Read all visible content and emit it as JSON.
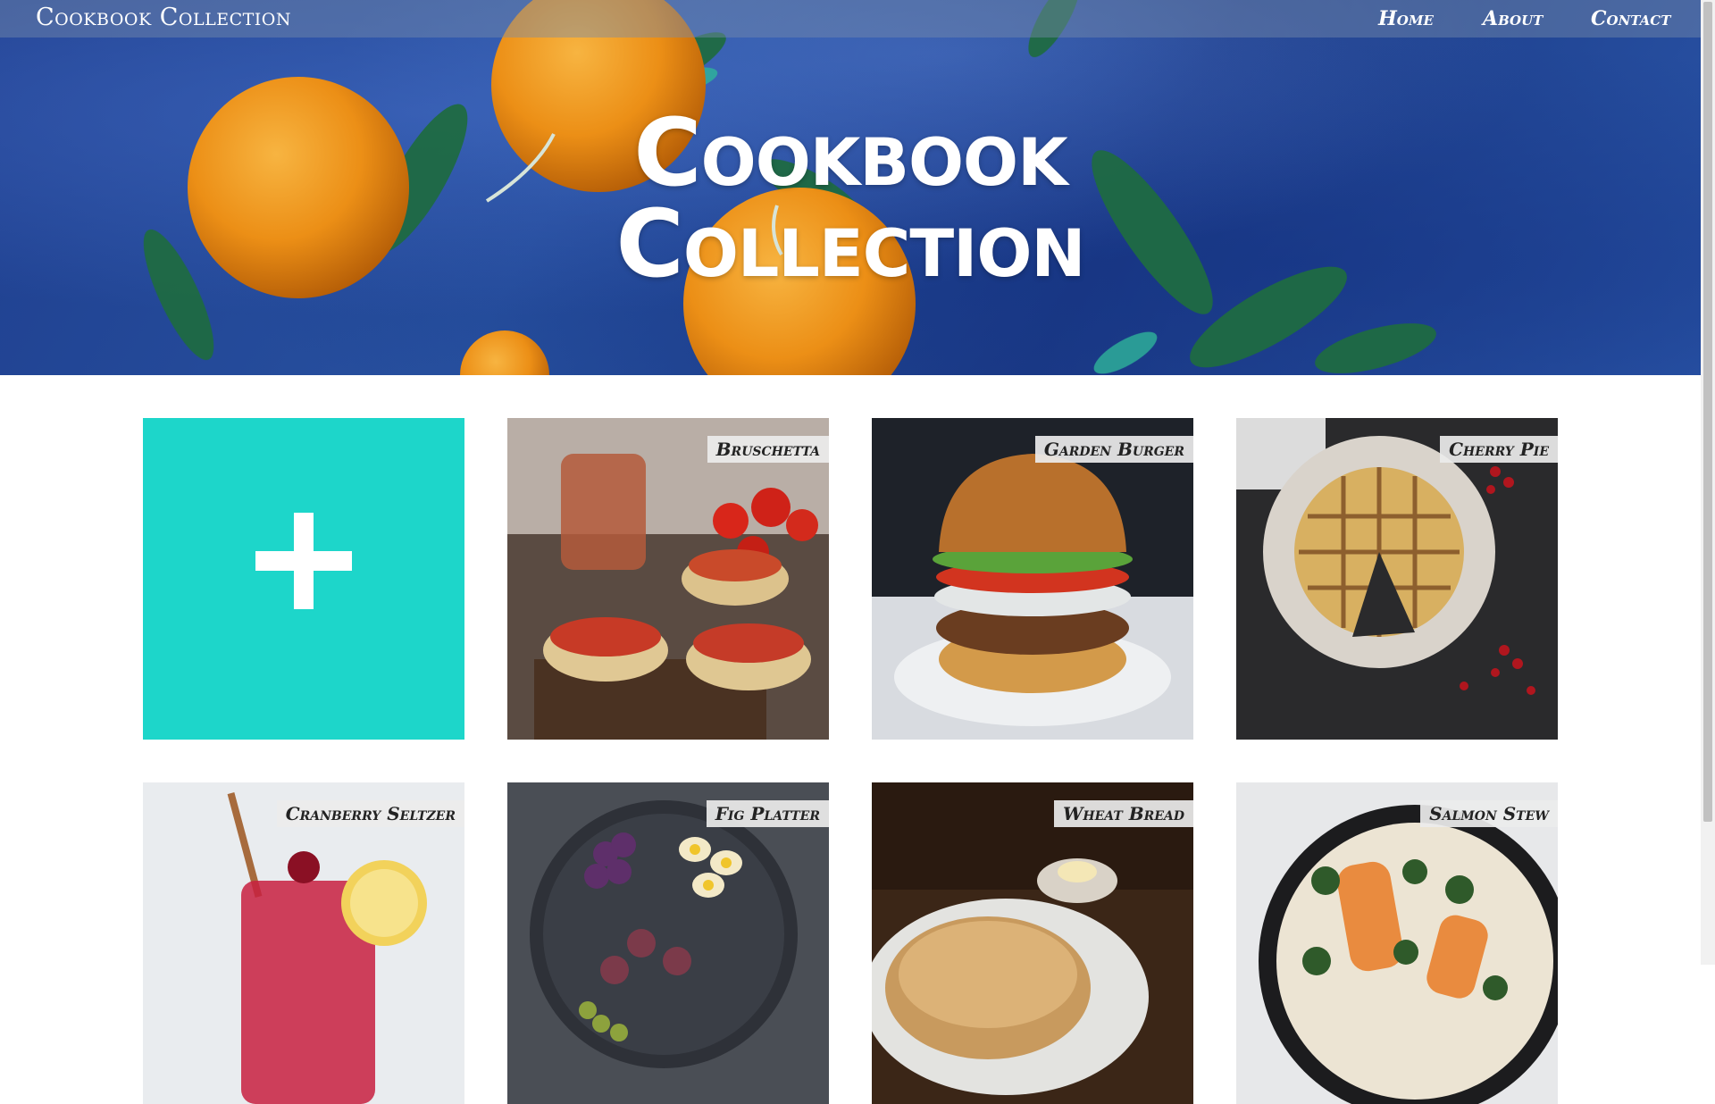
{
  "nav": {
    "brand": "Cookbook Collection",
    "links": [
      "Home",
      "About",
      "Contact"
    ]
  },
  "hero": {
    "title_line1": "Cookbook",
    "title_line2": "Collection"
  },
  "add_tile": {
    "icon": "plus-icon",
    "color": "#1dd6ca"
  },
  "recipes": [
    {
      "name": "Bruschetta"
    },
    {
      "name": "Garden Burger"
    },
    {
      "name": "Cherry Pie"
    },
    {
      "name": "Cranberry Seltzer"
    },
    {
      "name": "Fig Platter"
    },
    {
      "name": "Wheat Bread"
    },
    {
      "name": "Salmon Stew"
    }
  ]
}
